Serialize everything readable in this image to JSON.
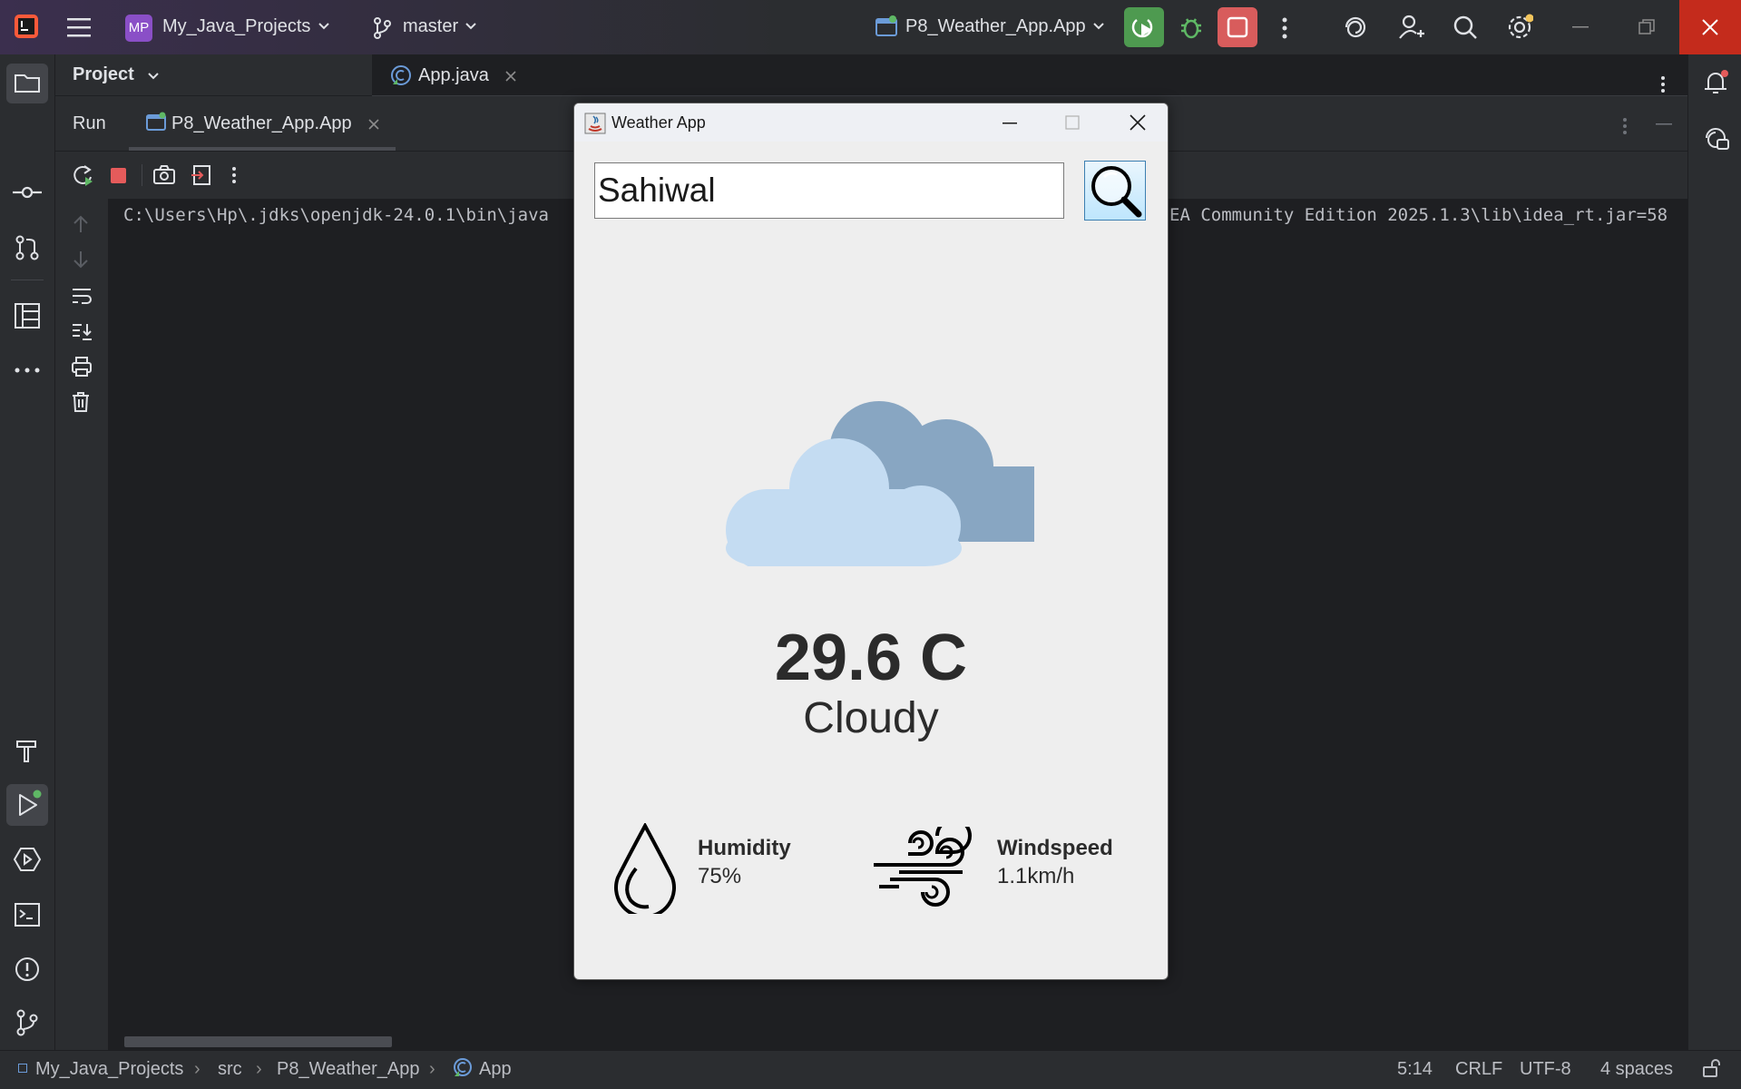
{
  "ide": {
    "project_badge": "MP",
    "project_name": "My_Java_Projects",
    "branch": "master",
    "run_config": "P8_Weather_App.App",
    "project_panel_label": "Project",
    "editor_tab": "App.java",
    "run_label": "Run",
    "run_tab": "P8_Weather_App.App",
    "console_left": "C:\\Users\\Hp\\.jdks\\openjdk-24.0.1\\bin\\java",
    "console_right": "EA Community Edition 2025.1.3\\lib\\idea_rt.jar=58"
  },
  "status_bar": {
    "breadcrumbs": [
      "My_Java_Projects",
      "src",
      "P8_Weather_App",
      "App"
    ],
    "position": "5:14",
    "line_sep": "CRLF",
    "encoding": "UTF-8",
    "indent": "4 spaces"
  },
  "weather_app": {
    "window_title": "Weather App",
    "city_input": "Sahiwal",
    "temperature": "29.6 C",
    "condition": "Cloudy",
    "humidity_label": "Humidity",
    "humidity_value": "75%",
    "windspeed_label": "Windspeed",
    "windspeed_value": "1.1km/h"
  },
  "colors": {
    "accent_green": "#4e9a50",
    "stop_red": "#d85c5c",
    "close_red": "#c42b1c",
    "cloud_front": "#c4dcf2",
    "cloud_back": "#88a6c2"
  }
}
